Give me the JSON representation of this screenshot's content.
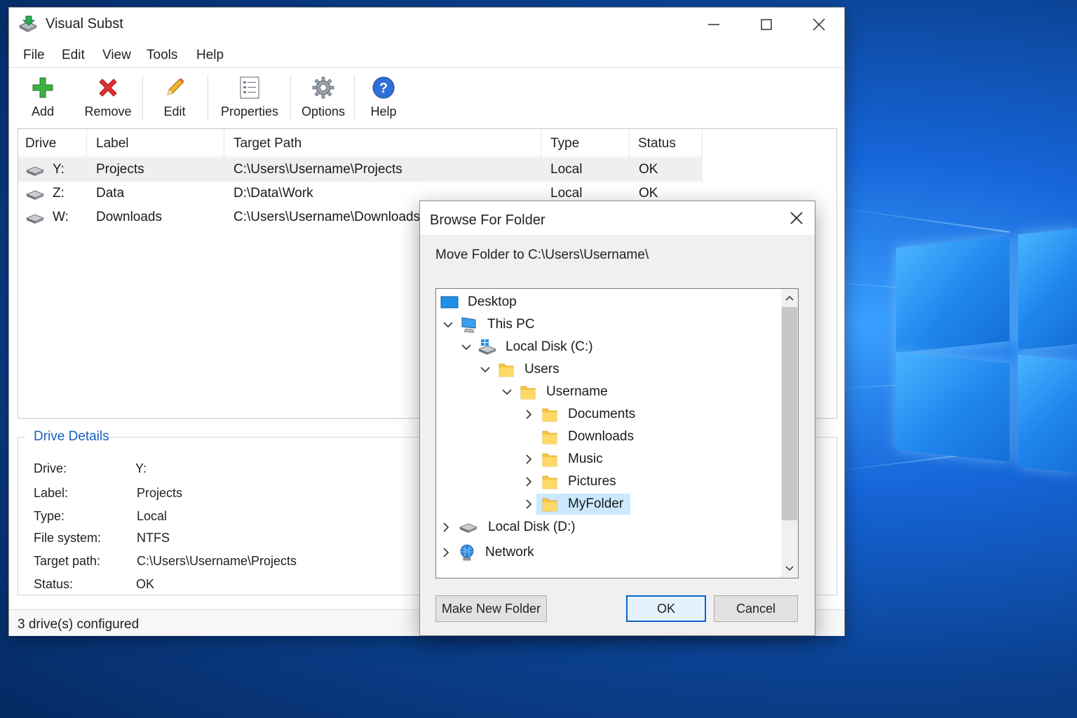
{
  "app": {
    "title": "Visual Subst",
    "accent_color": "#1a5fc2"
  },
  "window_controls": [
    "minimize-icon",
    "maximize-icon",
    "close-icon"
  ],
  "menu": [
    "File",
    "Edit",
    "View",
    "Tools",
    "Help"
  ],
  "toolbar": {
    "add": "Add",
    "remove": "Remove",
    "edit": "Edit",
    "properties": "Properties",
    "options": "Options",
    "help": "Help"
  },
  "drive_list": {
    "columns": [
      "Drive",
      "Label",
      "Target Path",
      "Type",
      "Status"
    ],
    "rows": [
      {
        "drive": "Y:",
        "label": "Projects",
        "path": "C:\\Users\\Username\\Projects",
        "type": "Local",
        "status": "OK"
      },
      {
        "drive": "Z:",
        "label": "Data",
        "path": "D:\\Data\\Work",
        "type": "Local",
        "status": "OK"
      },
      {
        "drive": "W:",
        "label": "Downloads",
        "path": "C:\\Users\\Username\\Downloads",
        "type": "",
        "status": ""
      }
    ]
  },
  "details": {
    "title": "Drive Details",
    "fields": [
      {
        "label": "Drive:",
        "value": "Y:"
      },
      {
        "label": "Label:",
        "value": "Projects"
      },
      {
        "label": "Type:",
        "value": "Local"
      },
      {
        "label": "File system:",
        "value": "NTFS"
      },
      {
        "label": "Target path:",
        "value": "C:\\Users\\Username\\Projects"
      },
      {
        "label": "Status:",
        "value": "OK"
      }
    ]
  },
  "status_bar": "3 drive(s) configured",
  "dialog": {
    "title": "Browse For Folder",
    "instruction": "Move Folder to C:\\Users\\Username\\",
    "tree": [
      {
        "label": "Desktop",
        "icon": "desktop-icon",
        "expander": "none"
      },
      {
        "label": "This PC",
        "icon": "computer-icon",
        "expander": "expanded"
      },
      {
        "label": "Local Disk (C:)",
        "icon": "system-drive-icon",
        "expander": "expanded"
      },
      {
        "label": "Users",
        "icon": "folder-icon",
        "expander": "expanded"
      },
      {
        "label": "Username",
        "icon": "folder-icon",
        "expander": "expanded"
      },
      {
        "label": "Documents",
        "icon": "folder-icon",
        "expander": "collapsed"
      },
      {
        "label": "Downloads",
        "icon": "folder-icon",
        "expander": "none"
      },
      {
        "label": "Music",
        "icon": "folder-icon",
        "expander": "collapsed"
      },
      {
        "label": "Pictures",
        "icon": "folder-icon",
        "expander": "collapsed"
      },
      {
        "label": "MyFolder",
        "icon": "folder-icon",
        "expander": "collapsed",
        "selected": true
      },
      {
        "label": "Local Disk (D:)",
        "icon": "drive-icon",
        "expander": "collapsed"
      },
      {
        "label": "Network",
        "icon": "network-icon",
        "expander": "collapsed"
      }
    ],
    "buttons": {
      "new_folder": "Make New Folder",
      "ok": "OK",
      "cancel": "Cancel"
    },
    "selection_color": "#cce8ff"
  }
}
